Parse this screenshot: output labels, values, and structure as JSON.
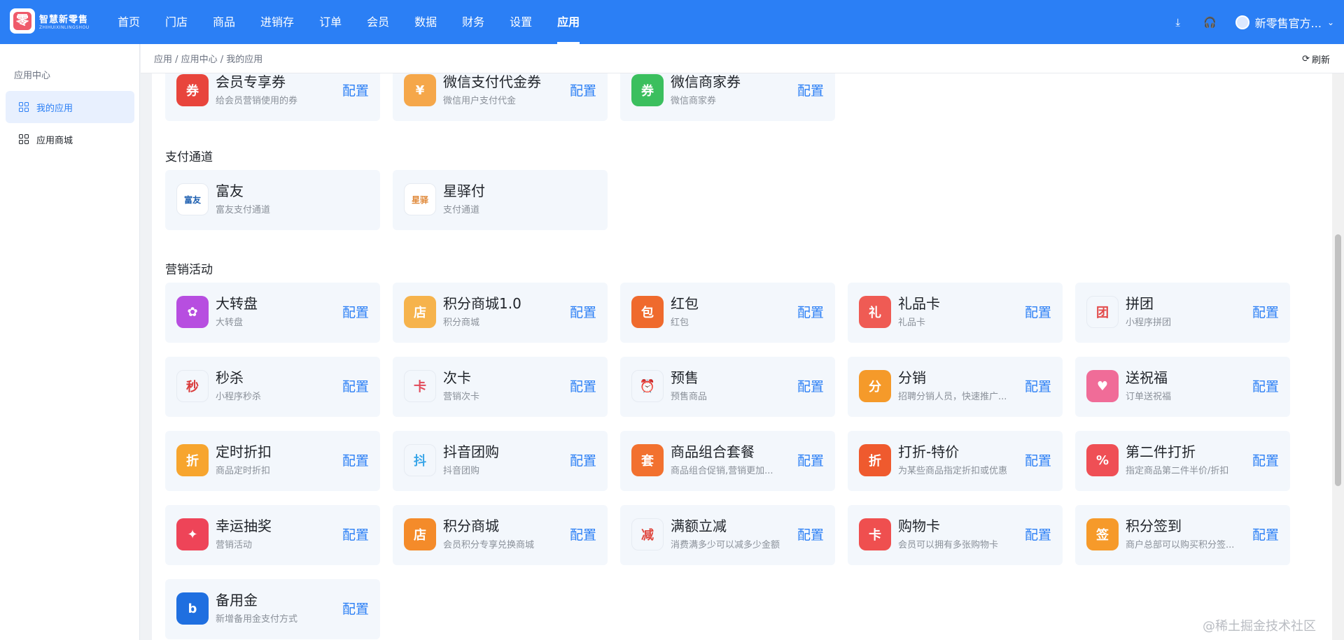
{
  "brand": {
    "name": "智慧新零售",
    "sub": "ZHIHUIXINLINGSHOU",
    "mark": "零"
  },
  "nav": [
    "首页",
    "门店",
    "商品",
    "进销存",
    "订单",
    "会员",
    "数据",
    "财务",
    "设置",
    "应用"
  ],
  "user": {
    "name": "新零售官方..."
  },
  "sidebar": {
    "title": "应用中心",
    "items": [
      {
        "label": "我的应用",
        "active": true
      },
      {
        "label": "应用商城",
        "active": false
      }
    ]
  },
  "breadcrumb": "应用 / 应用中心 / 我的应用",
  "refresh_label": "刷新",
  "config_label": "配置",
  "top_cards": [
    {
      "name": "会员专享券",
      "desc": "给会员营销使用的券",
      "color": "#e8453c",
      "icon": "coupon-icon",
      "glyph": "券"
    },
    {
      "name": "微信支付代金券",
      "desc": "微信用户支付代金",
      "color": "#f5a74a",
      "icon": "wallet-icon",
      "glyph": "¥"
    },
    {
      "name": "微信商家券",
      "desc": "微信商家券",
      "color": "#3bbf5e",
      "icon": "ticket-icon",
      "glyph": "券"
    }
  ],
  "sections": [
    {
      "title": "支付通道",
      "cards": [
        {
          "name": "富友",
          "desc": "富友支付通道",
          "color": "#ffffff",
          "text": "#1d5fb0",
          "icon": "fuiou-pay-icon",
          "glyph": "富友"
        },
        {
          "name": "星驿付",
          "desc": "支付通道",
          "color": "#ffffff",
          "text": "#e0893a",
          "icon": "xingyifu-icon",
          "glyph": "星驿"
        }
      ]
    },
    {
      "title": "营销活动",
      "cards": [
        {
          "name": "大转盘",
          "desc": "大转盘",
          "color": "#b74ee0",
          "icon": "wheel-icon",
          "glyph": "✿"
        },
        {
          "name": "积分商城1.0",
          "desc": "积分商城",
          "color": "#f6b34c",
          "icon": "store-icon",
          "glyph": "店"
        },
        {
          "name": "红包",
          "desc": "红包",
          "color": "#ef6a2d",
          "icon": "red-packet-icon",
          "glyph": "包"
        },
        {
          "name": "礼品卡",
          "desc": "礼品卡",
          "color": "#ef5b54",
          "icon": "gift-card-icon",
          "glyph": "礼"
        },
        {
          "name": "拼团",
          "desc": "小程序拼团",
          "color": "#f3f7fc",
          "text": "#e34b4b",
          "icon": "shopping-bag-icon",
          "glyph": "团"
        },
        {
          "name": "秒杀",
          "desc": "小程序秒杀",
          "color": "#f3f7fc",
          "text": "#d93a3a",
          "icon": "flash-sale-icon",
          "glyph": "秒"
        },
        {
          "name": "次卡",
          "desc": "营销次卡",
          "color": "#f3f7fc",
          "text": "#e24a5a",
          "icon": "card-icon",
          "glyph": "卡"
        },
        {
          "name": "预售",
          "desc": "预售商品",
          "color": "#f3f7fc",
          "text": "#f0a742",
          "icon": "alarm-clock-icon",
          "glyph": "⏰"
        },
        {
          "name": "分销",
          "desc": "招聘分销人员，快速推广...",
          "color": "#f59a2a",
          "icon": "share-bag-icon",
          "glyph": "分"
        },
        {
          "name": "送祝福",
          "desc": "订单送祝福",
          "color": "#f06c98",
          "icon": "blessing-icon",
          "glyph": "♥"
        },
        {
          "name": "定时折扣",
          "desc": "商品定时折扣",
          "color": "#f7a52e",
          "icon": "timed-discount-icon",
          "glyph": "折"
        },
        {
          "name": "抖音团购",
          "desc": "抖音团购",
          "color": "#f3f7fc",
          "text": "#3aa6e8",
          "icon": "douyin-icon",
          "glyph": "抖"
        },
        {
          "name": "商品组合套餐",
          "desc": "商品组合促销,营销更加...",
          "color": "#f2712f",
          "icon": "combo-icon",
          "glyph": "套"
        },
        {
          "name": "打折-特价",
          "desc": "为某些商品指定折扣或优惠",
          "color": "#ef5a2e",
          "icon": "discount-tag-icon",
          "glyph": "折"
        },
        {
          "name": "第二件打折",
          "desc": "指定商品第二件半价/折扣",
          "color": "#ef4f55",
          "icon": "second-discount-icon",
          "glyph": "%"
        },
        {
          "name": "幸运抽奖",
          "desc": "营销活动",
          "color": "#ee4458",
          "icon": "lottery-icon",
          "glyph": "✦"
        },
        {
          "name": "积分商城",
          "desc": "会员积分专享兑换商城",
          "color": "#f48b2a",
          "icon": "points-store-icon",
          "glyph": "店"
        },
        {
          "name": "满额立减",
          "desc": "消费满多少可以减多少金额",
          "color": "#f3f7fc",
          "text": "#e0483f",
          "icon": "full-reduction-icon",
          "glyph": "减"
        },
        {
          "name": "购物卡",
          "desc": "会员可以拥有多张购物卡",
          "color": "#ef4f4f",
          "icon": "shopping-card-icon",
          "glyph": "卡"
        },
        {
          "name": "积分签到",
          "desc": "商户总部可以购买积分签...",
          "color": "#f69a2a",
          "icon": "sign-in-icon",
          "glyph": "签"
        },
        {
          "name": "备用金",
          "desc": "新增备用金支付方式",
          "color": "#1f6fe0",
          "icon": "reserve-fund-icon",
          "glyph": "b"
        }
      ]
    }
  ],
  "watermark": "@稀土掘金技术社区"
}
